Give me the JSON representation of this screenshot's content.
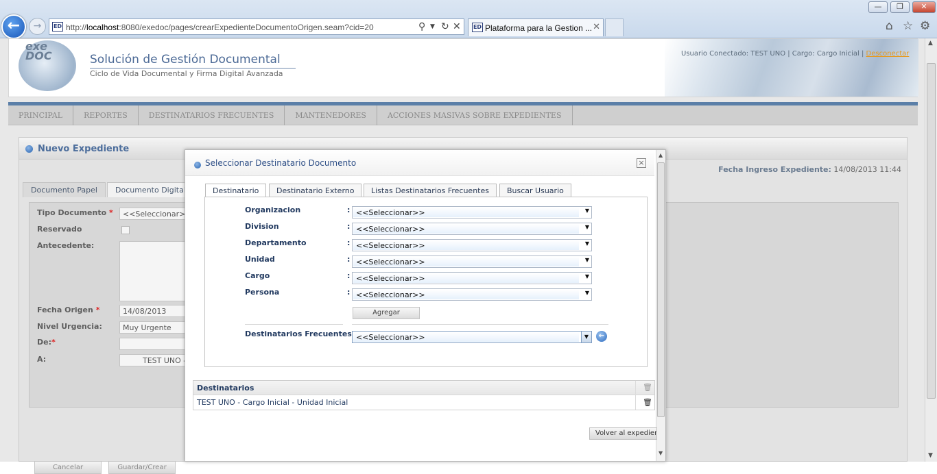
{
  "browser": {
    "url_prefix": "http://",
    "url_host": "localhost",
    "url_rest": ":8080/exedoc/pages/crearExpedienteDocumentoOrigen.seam?cid=20",
    "tab_title": "Plataforma para la Gestion ...",
    "favicon_text": "ED"
  },
  "header": {
    "logo_text": "exe DOC",
    "title": "Solución de Gestión Documental",
    "subtitle": "Ciclo de Vida Documental y Firma Digital Avanzada",
    "user_info": "Usuario Conectado: TEST UNO | Cargo: Cargo Inicial | ",
    "logout": "Desconectar"
  },
  "nav": {
    "items": [
      "PRINCIPAL",
      "REPORTES",
      "DESTINATARIOS FRECUENTES",
      "MANTENEDORES",
      "ACCIONES MASIVAS SOBRE EXPEDIENTES"
    ]
  },
  "panel": {
    "title": "Nuevo Expediente",
    "fecha_label": "Fecha Ingreso Expediente:",
    "fecha_value": "14/08/2013 11:44",
    "tabs": [
      "Documento Papel",
      "Documento Digital"
    ]
  },
  "form": {
    "tipo_label": "Tipo Documento",
    "tipo_value": "<<Seleccionar>>",
    "reservado_label": "Reservado",
    "antecedente_label": "Antecedente:",
    "fecha_origen_label": "Fecha Origen",
    "fecha_origen_value": "14/08/2013",
    "nivel_label": "Nivel Urgencia:",
    "nivel_value": "Muy Urgente",
    "de_label": "De:",
    "a_label": "A:",
    "a_value": "TEST UNO -",
    "required_mark": "*",
    "cancel": "Cancelar",
    "save": "Guardar/Crear"
  },
  "modal": {
    "title": "Seleccionar Destinatario Documento",
    "close": "×",
    "tabs": [
      "Destinatario",
      "Destinatario Externo",
      "Listas Destinatarios Frecuentes",
      "Buscar Usuario"
    ],
    "fields": [
      {
        "label": "Organizacion",
        "value": "<<Seleccionar>>"
      },
      {
        "label": "Division",
        "value": "<<Seleccionar>>"
      },
      {
        "label": "Departamento",
        "value": "<<Seleccionar>>"
      },
      {
        "label": "Unidad",
        "value": "<<Seleccionar>>"
      },
      {
        "label": "Cargo",
        "value": "<<Seleccionar>>"
      },
      {
        "label": "Persona",
        "value": "<<Seleccionar>>"
      }
    ],
    "colon": ":",
    "agregar": "Agregar",
    "frecuentes_label": "Destinatarios Frecuentes :",
    "frecuentes_value": "<<Seleccionar>>",
    "table_header": "Destinatarios",
    "rows": [
      "TEST UNO - Cargo Inicial - Unidad Inicial"
    ],
    "volver": "Volver al expediente"
  },
  "icons": {
    "back": "back-arrow-icon",
    "forward": "forward-arrow-icon",
    "search": "search-icon",
    "refresh": "refresh-icon",
    "stop": "close-icon",
    "home": "home-icon",
    "favorites": "star-icon",
    "settings": "gear-icon",
    "trash": "trash-icon",
    "go": "go-arrow-icon"
  },
  "colors": {
    "nav_stripe": "#5b7fa8",
    "modal_title": "#2d4e86",
    "link_orange": "#e79a1f"
  }
}
